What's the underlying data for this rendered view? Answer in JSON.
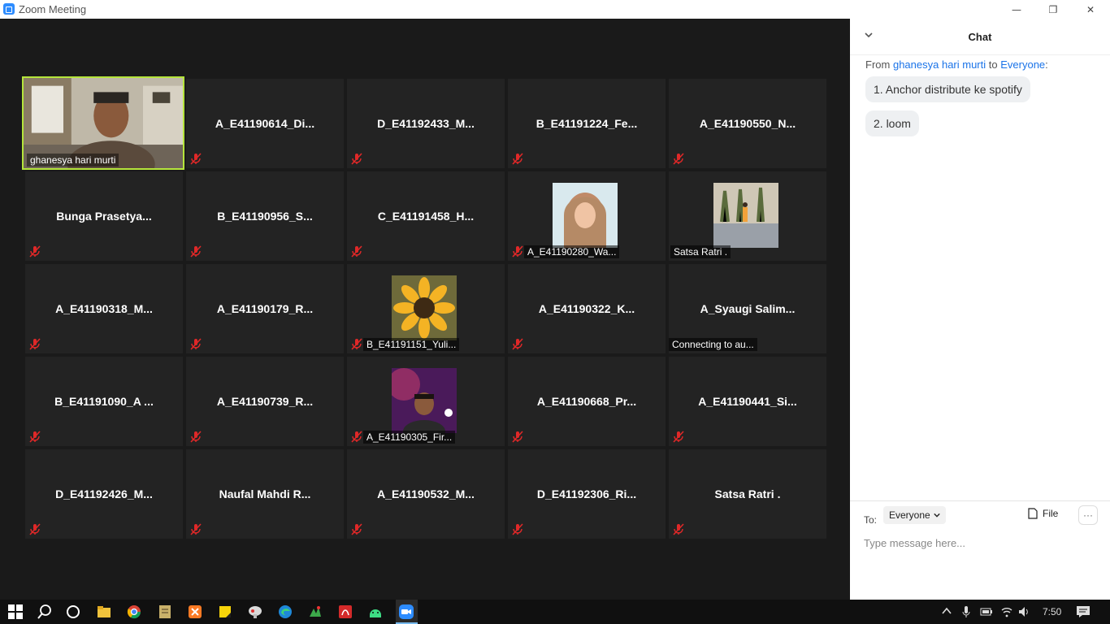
{
  "window": {
    "title": "Zoom Meeting",
    "controls": [
      "minimize",
      "restore",
      "close"
    ],
    "min_icon": "—",
    "max_icon": "❐",
    "close_icon": "✕"
  },
  "active_speaker": {
    "name": "ghanesya hari murti"
  },
  "tiles": [
    {
      "text": "A_E41190614_Di...",
      "style": "name",
      "muted": true
    },
    {
      "text": "D_E41192433_M...",
      "style": "name",
      "muted": true
    },
    {
      "text": "B_E41191224_Fe...",
      "style": "name",
      "muted": true
    },
    {
      "text": "A_E41190550_N...",
      "style": "name",
      "muted": true
    },
    {
      "text": "Bunga  Prasetya...",
      "style": "name",
      "muted": true
    },
    {
      "text": "B_E41190956_S...",
      "style": "name",
      "muted": true
    },
    {
      "text": "C_E41191458_H...",
      "style": "name",
      "muted": true
    },
    {
      "text": "A_E41190280_Wa...",
      "style": "photo",
      "muted": true
    },
    {
      "text": "Satsa Ratri .",
      "style": "photo",
      "muted": false
    },
    {
      "text": "A_E41190318_M...",
      "style": "name",
      "muted": true
    },
    {
      "text": "A_E41190179_R...",
      "style": "name",
      "muted": true
    },
    {
      "text": "B_E41191151_Yuli...",
      "style": "photo",
      "muted": true
    },
    {
      "text": "A_E41190322_K...",
      "style": "name",
      "muted": true
    },
    {
      "text": "A_Syaugi  Salim...",
      "style": "name",
      "muted": false,
      "status": "Connecting to au..."
    },
    {
      "text": "B_E41191090_A ...",
      "style": "name",
      "muted": true
    },
    {
      "text": "A_E41190739_R...",
      "style": "name",
      "muted": true
    },
    {
      "text": "A_E41190305_Fir...",
      "style": "photo",
      "muted": true
    },
    {
      "text": "A_E41190668_Pr...",
      "style": "name",
      "muted": true
    },
    {
      "text": "A_E41190441_Si...",
      "style": "name",
      "muted": true
    },
    {
      "text": "D_E41192426_M...",
      "style": "name",
      "muted": true
    },
    {
      "text": "Naufal  Mahdi  R...",
      "style": "name",
      "muted": true
    },
    {
      "text": "A_E41190532_M...",
      "style": "name",
      "muted": true
    },
    {
      "text": "D_E41192306_Ri...",
      "style": "name",
      "muted": true
    },
    {
      "text": "Satsa Ratri .",
      "style": "name",
      "muted": true
    }
  ],
  "chat": {
    "title": "Chat",
    "from_label": "From",
    "from_name": "ghanesya hari murti",
    "to_label": "to",
    "to_name": "Everyone",
    "messages": [
      "1. Anchor distribute ke spotify",
      "2. loom"
    ],
    "recipient_label": "To:",
    "recipient": "Everyone",
    "file_label": "File",
    "more_label": "···",
    "placeholder": "Type message here..."
  },
  "taskbar": {
    "time": "7:50"
  },
  "colors": {
    "accent": "#2d8cff",
    "active_border": "#b5e53b",
    "mute_red": "#e02828",
    "tile_bg": "#232323",
    "stage_bg": "#1a1a1a",
    "link_blue": "#1a73e8"
  }
}
